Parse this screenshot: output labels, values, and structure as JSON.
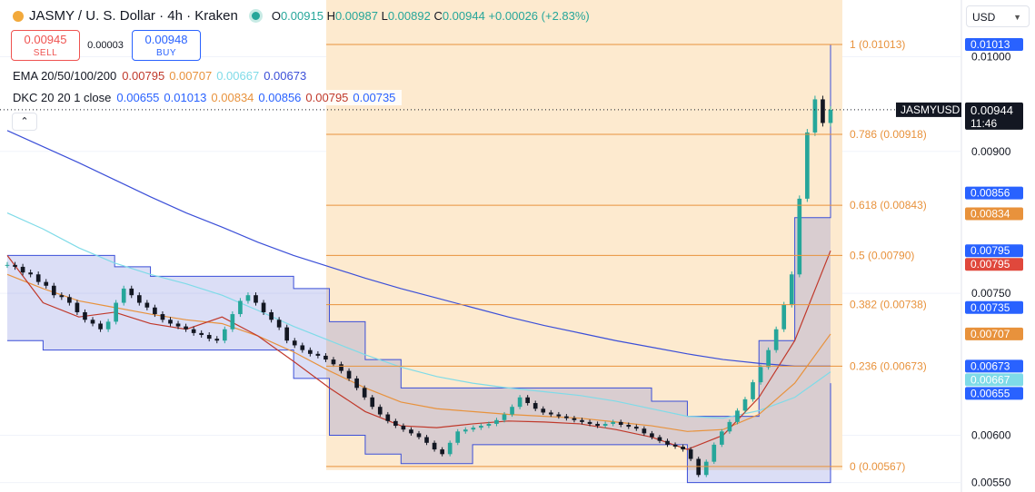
{
  "header": {
    "symbol_title": "JASMY / U. S. Dollar · 4h · Kraken",
    "ohlc": {
      "o_label": "O",
      "o": "0.00915",
      "h_label": "H",
      "h": "0.00987",
      "l_label": "L",
      "l": "0.00892",
      "c_label": "C",
      "c": "0.00944",
      "change": "+0.00026 (+2.83%)"
    },
    "sell_price": "0.00945",
    "sell_label": "SELL",
    "spread": "0.00003",
    "buy_price": "0.00948",
    "buy_label": "BUY"
  },
  "indicators": {
    "ema": {
      "label": "EMA 20/50/100/200",
      "values": [
        "0.00795",
        "0.00707",
        "0.00667",
        "0.00673"
      ],
      "colors": [
        "#c0392b",
        "#e8923c",
        "#7fdbe8",
        "#3b4fd8"
      ]
    },
    "dkc": {
      "label": "DKC 20 20 1 close",
      "values": [
        "0.00655",
        "0.01013",
        "0.00834",
        "0.00856",
        "0.00795",
        "0.00735"
      ],
      "colors": [
        "#2962ff",
        "#2962ff",
        "#e8923c",
        "#2962ff",
        "#c0392b",
        "#2962ff"
      ]
    }
  },
  "currency_selector": "USD",
  "chart_data": {
    "type": "candlestick",
    "symbol": "JASMYUSD",
    "timeframe": "4h",
    "y_ticks": [
      "0.00550",
      "0.00600",
      "0.00750",
      "0.00900",
      "0.01000"
    ],
    "ylim": [
      0.0054,
      0.0106
    ],
    "current_price": {
      "label": "JASMYUSD",
      "value": "0.00944",
      "countdown": "11:46",
      "price": 0.00944
    },
    "price_tags": [
      {
        "text": "0.01013",
        "price": 0.01013,
        "bg": "#2962ff"
      },
      {
        "text": "0.00856",
        "price": 0.00856,
        "bg": "#2962ff"
      },
      {
        "text": "0.00834",
        "price": 0.00834,
        "bg": "#e8923c"
      },
      {
        "text": "0.00795",
        "price": 0.00795,
        "bg": "#2962ff"
      },
      {
        "text": "0.00795",
        "price": 0.00795,
        "bg": "#e0483c"
      },
      {
        "text": "0.00735",
        "price": 0.00735,
        "bg": "#2962ff"
      },
      {
        "text": "0.00707",
        "price": 0.00707,
        "bg": "#e8923c"
      },
      {
        "text": "0.00673",
        "price": 0.00673,
        "bg": "#2962ff"
      },
      {
        "text": "0.00667",
        "price": 0.00667,
        "bg": "#7fdbe8"
      },
      {
        "text": "0.00655",
        "price": 0.00655,
        "bg": "#2962ff"
      }
    ],
    "fibonacci": [
      {
        "level": "1",
        "price": 0.01013,
        "label": "1 (0.01013)"
      },
      {
        "level": "0.786",
        "price": 0.00918,
        "label": "0.786 (0.00918)"
      },
      {
        "level": "0.618",
        "price": 0.00843,
        "label": "0.618 (0.00843)"
      },
      {
        "level": "0.5",
        "price": 0.0079,
        "label": "0.5 (0.00790)"
      },
      {
        "level": "0.382",
        "price": 0.00738,
        "label": "0.382 (0.00738)"
      },
      {
        "level": "0.236",
        "price": 0.00673,
        "label": "0.236 (0.00673)"
      },
      {
        "level": "0",
        "price": 0.00567,
        "label": "0 (0.00567)"
      }
    ],
    "fib_color": "#e8923c",
    "up_color": "#26a69a",
    "down_color": "#131722",
    "price_path": [
      0.0078,
      0.00778,
      0.00772,
      0.0077,
      0.00762,
      0.00758,
      0.00748,
      0.00746,
      0.0074,
      0.0073,
      0.00722,
      0.00718,
      0.00712,
      0.0072,
      0.0074,
      0.00755,
      0.00748,
      0.0074,
      0.00735,
      0.00728,
      0.00722,
      0.00718,
      0.00715,
      0.00712,
      0.00708,
      0.00706,
      0.00702,
      0.007,
      0.00712,
      0.00728,
      0.00742,
      0.00748,
      0.0074,
      0.0073,
      0.00722,
      0.00714,
      0.007,
      0.00695,
      0.0069,
      0.00686,
      0.00684,
      0.0068,
      0.00675,
      0.00668,
      0.0066,
      0.0065,
      0.0064,
      0.0063,
      0.00622,
      0.00615,
      0.0061,
      0.00606,
      0.00602,
      0.00598,
      0.00592,
      0.00585,
      0.0058,
      0.00592,
      0.00604,
      0.00606,
      0.00608,
      0.0061,
      0.00612,
      0.00616,
      0.00622,
      0.0063,
      0.0064,
      0.00634,
      0.00628,
      0.00624,
      0.00622,
      0.0062,
      0.00618,
      0.00616,
      0.00614,
      0.00612,
      0.0061,
      0.00612,
      0.00614,
      0.00611,
      0.00609,
      0.00607,
      0.00602,
      0.00598,
      0.00594,
      0.0059,
      0.00588,
      0.00585,
      0.00575,
      0.00558,
      0.00572,
      0.0059,
      0.00604,
      0.00614,
      0.00626,
      0.00638,
      0.00656,
      0.00672,
      0.0069,
      0.00712,
      0.00738,
      0.0077,
      0.0085,
      0.0092,
      0.00955,
      0.0093,
      0.00944
    ],
    "ema20": [
      0.0079,
      0.0074,
      0.00725,
      0.0073,
      0.00718,
      0.00712,
      0.00725,
      0.00705,
      0.00678,
      0.0065,
      0.00625,
      0.0061,
      0.00608,
      0.00612,
      0.00615,
      0.00614,
      0.00612,
      0.00606,
      0.00598,
      0.00585,
      0.006,
      0.0064,
      0.007,
      0.00795
    ],
    "ema50": [
      0.0077,
      0.00755,
      0.00742,
      0.00735,
      0.00728,
      0.00722,
      0.00718,
      0.00705,
      0.00688,
      0.00668,
      0.0065,
      0.00635,
      0.00628,
      0.00625,
      0.00622,
      0.0062,
      0.00618,
      0.00614,
      0.0061,
      0.00604,
      0.00606,
      0.00622,
      0.00655,
      0.00707
    ],
    "ema100": [
      0.00835,
      0.00818,
      0.00798,
      0.00782,
      0.0077,
      0.0076,
      0.00748,
      0.00732,
      0.00715,
      0.007,
      0.00685,
      0.00672,
      0.00662,
      0.00655,
      0.0065,
      0.00646,
      0.00642,
      0.00636,
      0.00628,
      0.0062,
      0.00618,
      0.00626,
      0.0064,
      0.00667
    ],
    "ema200": [
      0.00922,
      0.00905,
      0.00888,
      0.0087,
      0.00852,
      0.00835,
      0.0082,
      0.00804,
      0.0079,
      0.00778,
      0.00766,
      0.00755,
      0.00745,
      0.00735,
      0.00725,
      0.00716,
      0.00708,
      0.007,
      0.00693,
      0.00686,
      0.0068,
      0.00676,
      0.00673,
      0.00673
    ],
    "dkc_upper": [
      0.0079,
      0.0079,
      0.0079,
      0.00778,
      0.00768,
      0.00768,
      0.00768,
      0.00768,
      0.00755,
      0.0072,
      0.0068,
      0.0065,
      0.0065,
      0.0065,
      0.0065,
      0.0065,
      0.0065,
      0.0065,
      0.00636,
      0.0062,
      0.0062,
      0.007,
      0.0083,
      0.01013
    ],
    "dkc_lower": [
      0.007,
      0.0069,
      0.0069,
      0.0069,
      0.0069,
      0.0069,
      0.0069,
      0.0069,
      0.0066,
      0.006,
      0.0058,
      0.0057,
      0.0057,
      0.0059,
      0.0059,
      0.0059,
      0.0059,
      0.0059,
      0.0059,
      0.0055,
      0.0055,
      0.0055,
      0.0055,
      0.00655
    ]
  }
}
